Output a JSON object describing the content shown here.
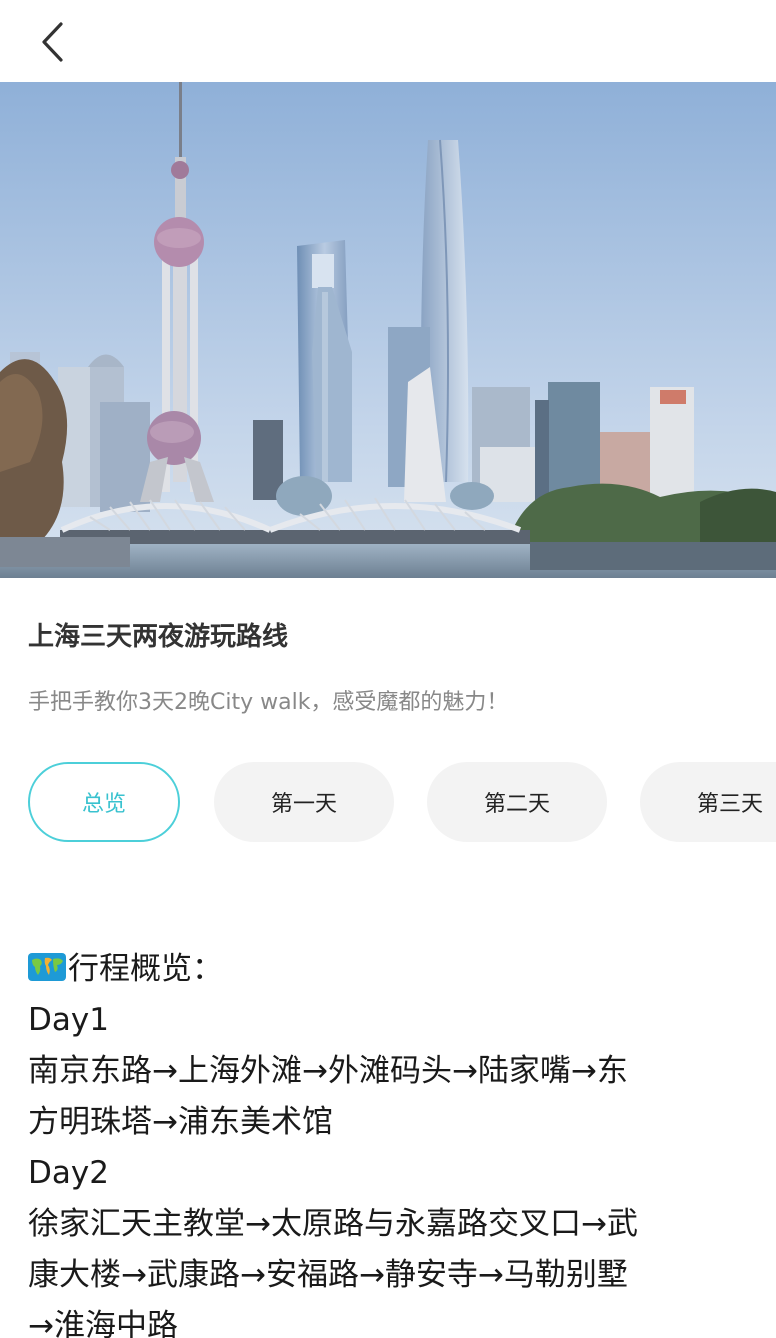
{
  "nav": {
    "back_icon": "chevron-left-icon"
  },
  "hero": {
    "image": "shanghai-skyline-photo"
  },
  "article": {
    "title": "上海三天两夜游玩路线",
    "subtitle": "手把手教你3天2晚City walk，感受魔都的魅力！"
  },
  "tabs": [
    {
      "label": "总览",
      "active": true
    },
    {
      "label": "第一天",
      "active": false
    },
    {
      "label": "第二天",
      "active": false
    },
    {
      "label": "第三天",
      "active": false
    }
  ],
  "colors": {
    "accent": "#39c2cf",
    "tab_bg": "#f3f3f3"
  },
  "overview": {
    "icon": "world-map-icon",
    "heading": "行程概览：",
    "day1_label": "Day1",
    "day1_route_1": "南京东路→上海外滩→外滩码头→陆家嘴→东",
    "day1_route_2": "方明珠塔→浦东美术馆",
    "day2_label": "Day2",
    "day2_route_1": "徐家汇天主教堂→太原路与永嘉路交叉口→武",
    "day2_route_2": "康大楼→武康路→安福路→静安寺→马勒别墅",
    "day2_route_3": "→淮海中路"
  }
}
